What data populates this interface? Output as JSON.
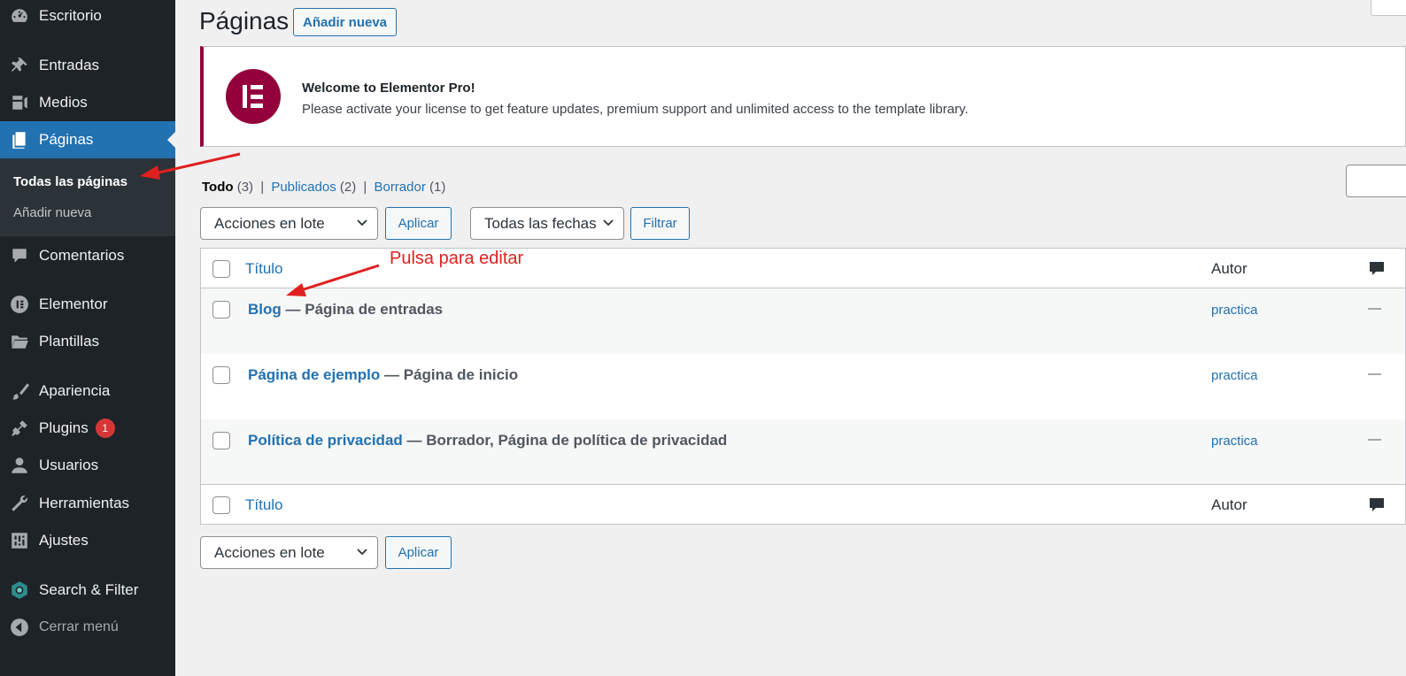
{
  "sidebar": {
    "items": [
      {
        "label": "Escritorio",
        "icon": "dashboard-icon"
      },
      {
        "label": "Entradas",
        "icon": "pin-icon"
      },
      {
        "label": "Medios",
        "icon": "media-icon"
      },
      {
        "label": "Páginas",
        "icon": "pages-icon"
      },
      {
        "label": "Comentarios",
        "icon": "comment-icon"
      },
      {
        "label": "Elementor",
        "icon": "elementor-icon"
      },
      {
        "label": "Plantillas",
        "icon": "folder-icon"
      },
      {
        "label": "Apariencia",
        "icon": "brush-icon"
      },
      {
        "label": "Plugins",
        "icon": "plugin-icon",
        "badge": "1"
      },
      {
        "label": "Usuarios",
        "icon": "user-icon"
      },
      {
        "label": "Herramientas",
        "icon": "wrench-icon"
      },
      {
        "label": "Ajustes",
        "icon": "settings-icon"
      },
      {
        "label": "Search & Filter",
        "icon": "search-filter-icon"
      },
      {
        "label": "Cerrar menú",
        "icon": "collapse-icon"
      }
    ],
    "submenu": {
      "all_pages": "Todas las páginas",
      "add_new": "Añadir nueva"
    }
  },
  "header": {
    "title": "Páginas",
    "add_new": "Añadir nueva"
  },
  "notice": {
    "title": "Welcome to Elementor Pro!",
    "text": "Please activate your license to get feature updates, premium support and unlimited access to the template library."
  },
  "views": {
    "all": "Todo",
    "all_count": "(3)",
    "published": "Publicados",
    "published_count": "(2)",
    "draft": "Borrador",
    "draft_count": "(1)",
    "sep": "|"
  },
  "filters": {
    "bulk_actions": "Acciones en lote",
    "apply": "Aplicar",
    "dates": "Todas las fechas",
    "filter": "Filtrar"
  },
  "table": {
    "col_title": "Título",
    "col_author": "Autor",
    "rows": [
      {
        "title": "Blog",
        "state": " — Página de entradas",
        "author": "practica",
        "comments": "—"
      },
      {
        "title": "Página de ejemplo",
        "state": " — Página de inicio",
        "author": "practica",
        "comments": "—"
      },
      {
        "title": "Política de privacidad",
        "state": " — Borrador, Página de política de privacidad",
        "author": "practica",
        "comments": "—"
      }
    ]
  },
  "annotation": {
    "text": "Pulsa para editar",
    "color": "#e02020"
  },
  "colors": {
    "sidebar_bg": "#1d2327",
    "accent": "#2271b1",
    "elementor": "#93003c",
    "badge": "#d63638"
  }
}
